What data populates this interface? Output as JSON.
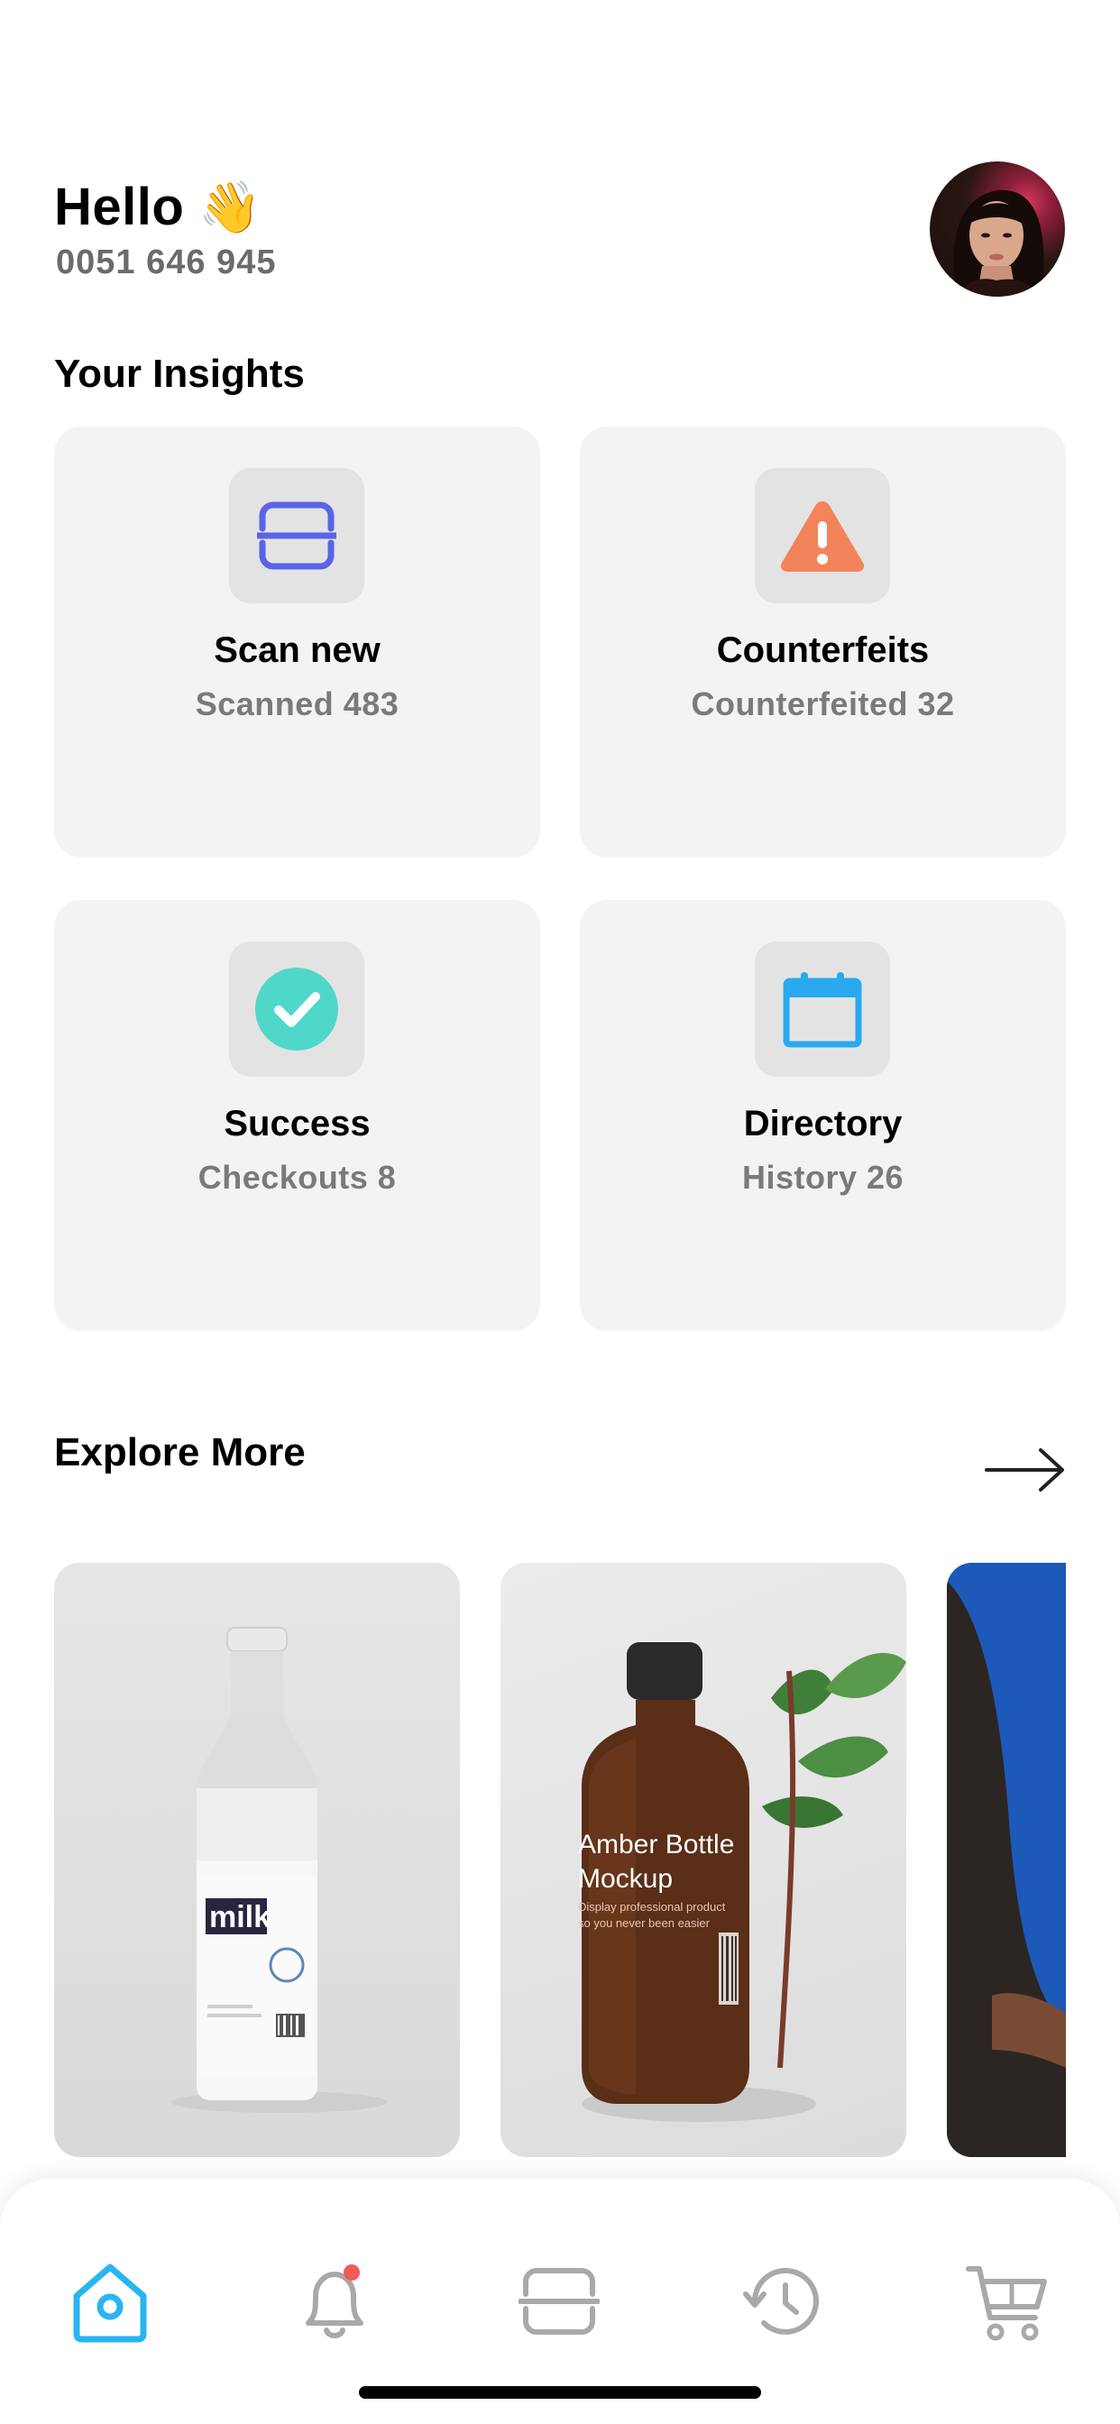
{
  "header": {
    "greeting": "Hello",
    "wave_emoji": "👋",
    "phone": "0051 646 945",
    "avatar": "profile-photo"
  },
  "insights": {
    "title": "Your Insights",
    "cards": [
      {
        "title": "Scan new",
        "subtitle": "Scanned 483",
        "icon": "scan-icon",
        "icon_color": "#5b63e6"
      },
      {
        "title": "Counterfeits",
        "subtitle": "Counterfeited 32",
        "icon": "warning-icon",
        "icon_color": "#f3835a"
      },
      {
        "title": "Success",
        "subtitle": "Checkouts 8",
        "icon": "check-circle-icon",
        "icon_color": "#4fd8c9"
      },
      {
        "title": "Directory",
        "subtitle": "History 26",
        "icon": "calendar-icon",
        "icon_color": "#29a9f0"
      }
    ]
  },
  "explore": {
    "title": "Explore More",
    "arrow_icon": "arrow-right-icon",
    "items": [
      {
        "image": "milk-bottle",
        "label": "milk"
      },
      {
        "image": "amber-bottle",
        "headline": "Amber Bottle Mockup",
        "tagline": "Display professional product so you never been easier"
      },
      {
        "image": "person-blue-background"
      }
    ]
  },
  "nav": {
    "active_color": "#29b4f2",
    "inactive_color": "#a9a9a9",
    "badge_color": "#f25a5a",
    "items": [
      "home-icon",
      "bell-icon",
      "scan-icon",
      "history-icon",
      "cart-icon"
    ],
    "active_index": 0
  }
}
